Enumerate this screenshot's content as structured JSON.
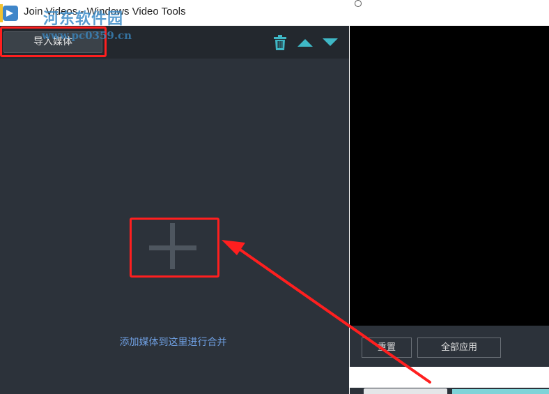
{
  "window": {
    "title": "Join Videos - Windows Video Tools"
  },
  "watermark": {
    "main": "河东软件园",
    "sub": "www.pc0359.cn"
  },
  "toolbar": {
    "import_label": "导入媒体",
    "icons": [
      "trash-icon",
      "move-up-icon",
      "move-down-icon"
    ]
  },
  "media_area": {
    "add_hint": "添加媒体到这里进行合并",
    "add_icon": "plus-icon"
  },
  "controls": {
    "reset_label": "重置",
    "apply_all_label": "全部应用"
  },
  "colors": {
    "panel": "#2c323a",
    "toolbar": "#23282e",
    "accent": "#3fb8c6",
    "highlight": "#ff1f1f",
    "hint_text": "#6e9ee0"
  }
}
